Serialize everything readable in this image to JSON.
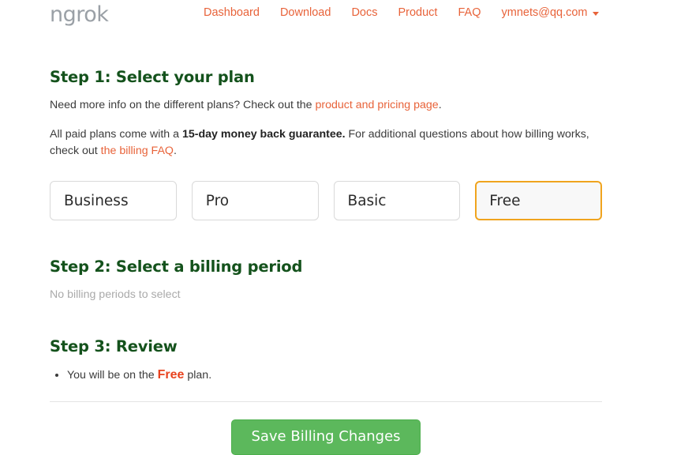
{
  "header": {
    "brand": "ngrok",
    "nav_items": [
      {
        "label": "Dashboard"
      },
      {
        "label": "Download"
      },
      {
        "label": "Docs"
      },
      {
        "label": "Product"
      },
      {
        "label": "FAQ"
      }
    ],
    "user": {
      "email": "ymnets@qq.com",
      "caret_icon": "chevron-down-icon"
    }
  },
  "step1": {
    "title": "Step 1: Select your plan",
    "info_prefix": "Need more info on the different plans? Check out the ",
    "info_link": "product and pricing page",
    "info_suffix": ".",
    "guarantee_prefix": "All paid plans come with a ",
    "guarantee_bold": "15-day money back guarantee.",
    "guarantee_mid": " For additional questions about how billing works, check out ",
    "guarantee_link": "the billing FAQ",
    "guarantee_suffix": ".",
    "plans": [
      {
        "label": "Business",
        "selected": false
      },
      {
        "label": "Pro",
        "selected": false
      },
      {
        "label": "Basic",
        "selected": false
      },
      {
        "label": "Free",
        "selected": true
      }
    ]
  },
  "step2": {
    "title": "Step 2: Select a billing period",
    "empty_message": "No billing periods to select"
  },
  "step3": {
    "title": "Step 3: Review",
    "review_prefix": "You will be on the ",
    "review_plan": "Free",
    "review_suffix": " plan."
  },
  "footer": {
    "save_label": "Save Billing Changes"
  },
  "colors": {
    "link": "#e8633a",
    "heading_green": "#14521c",
    "selected_border": "#f0a41e",
    "save_green": "#5cb85c",
    "free_red": "#e8431f",
    "muted": "#aaaaaa",
    "brand_gray": "#9aa0a6"
  }
}
